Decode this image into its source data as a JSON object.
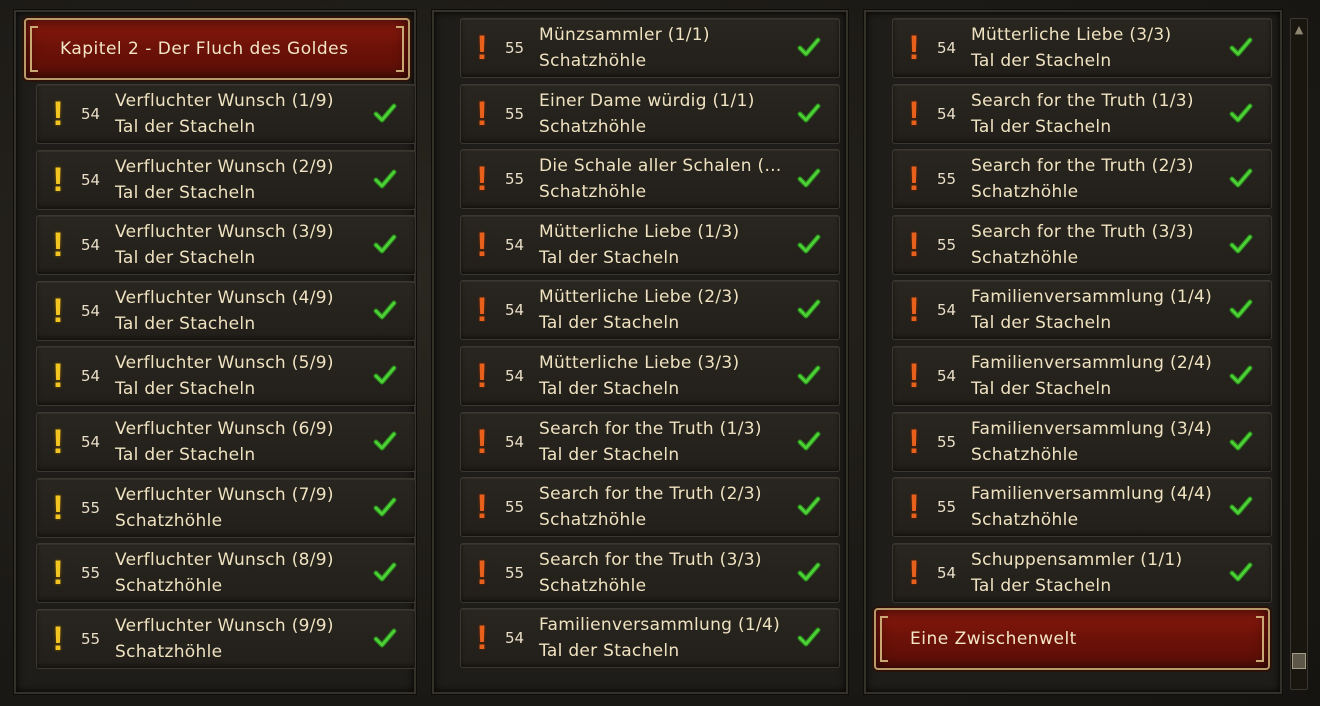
{
  "chapters": [
    {
      "title": "Kapitel 2 - Der Fluch des Goldes"
    },
    {
      "title": "Eine Zwischenwelt"
    }
  ],
  "colors": {
    "yellow_marker": "#f2c523",
    "orange_marker": "#e8611c",
    "check": "#3fbf2a",
    "chapter_red": "#6e1208"
  },
  "icons": {
    "marker": "exclamation-icon",
    "done": "checkmark-icon"
  },
  "quests": {
    "col1": [
      {
        "level": "54",
        "name": "Verfluchter Wunsch (1/9)",
        "zone": "Tal der Stacheln",
        "marker": "yellow"
      },
      {
        "level": "54",
        "name": "Verfluchter Wunsch (2/9)",
        "zone": "Tal der Stacheln",
        "marker": "yellow"
      },
      {
        "level": "54",
        "name": "Verfluchter Wunsch (3/9)",
        "zone": "Tal der Stacheln",
        "marker": "yellow"
      },
      {
        "level": "54",
        "name": "Verfluchter Wunsch (4/9)",
        "zone": "Tal der Stacheln",
        "marker": "yellow"
      },
      {
        "level": "54",
        "name": "Verfluchter Wunsch (5/9)",
        "zone": "Tal der Stacheln",
        "marker": "yellow"
      },
      {
        "level": "54",
        "name": "Verfluchter Wunsch (6/9)",
        "zone": "Tal der Stacheln",
        "marker": "yellow"
      },
      {
        "level": "55",
        "name": "Verfluchter Wunsch (7/9)",
        "zone": "Schatzhöhle",
        "marker": "yellow"
      },
      {
        "level": "55",
        "name": "Verfluchter Wunsch (8/9)",
        "zone": "Schatzhöhle",
        "marker": "yellow"
      },
      {
        "level": "55",
        "name": "Verfluchter Wunsch (9/9)",
        "zone": "Schatzhöhle",
        "marker": "yellow"
      }
    ],
    "col2": [
      {
        "level": "55",
        "name": "Münzsammler (1/1)",
        "zone": "Schatzhöhle",
        "marker": "orange"
      },
      {
        "level": "55",
        "name": "Einer Dame würdig (1/1)",
        "zone": "Schatzhöhle",
        "marker": "orange"
      },
      {
        "level": "55",
        "name": "Die Schale aller Schalen (…",
        "zone": "Schatzhöhle",
        "marker": "orange"
      },
      {
        "level": "54",
        "name": "Mütterliche Liebe (1/3)",
        "zone": "Tal der Stacheln",
        "marker": "orange"
      },
      {
        "level": "54",
        "name": "Mütterliche Liebe (2/3)",
        "zone": "Tal der Stacheln",
        "marker": "orange"
      },
      {
        "level": "54",
        "name": "Mütterliche Liebe (3/3)",
        "zone": "Tal der Stacheln",
        "marker": "orange"
      },
      {
        "level": "54",
        "name": "Search for the Truth (1/3)",
        "zone": "Tal der Stacheln",
        "marker": "orange"
      },
      {
        "level": "55",
        "name": "Search for the Truth (2/3)",
        "zone": "Schatzhöhle",
        "marker": "orange"
      },
      {
        "level": "55",
        "name": "Search for the Truth (3/3)",
        "zone": "Schatzhöhle",
        "marker": "orange"
      },
      {
        "level": "54",
        "name": "Familienversammlung (1/4)",
        "zone": "Tal der Stacheln",
        "marker": "orange"
      }
    ],
    "col3": [
      {
        "level": "54",
        "name": "Mütterliche Liebe (3/3)",
        "zone": "Tal der Stacheln",
        "marker": "orange"
      },
      {
        "level": "54",
        "name": "Search for the Truth (1/3)",
        "zone": "Tal der Stacheln",
        "marker": "orange"
      },
      {
        "level": "55",
        "name": "Search for the Truth (2/3)",
        "zone": "Schatzhöhle",
        "marker": "orange"
      },
      {
        "level": "55",
        "name": "Search for the Truth (3/3)",
        "zone": "Schatzhöhle",
        "marker": "orange"
      },
      {
        "level": "54",
        "name": "Familienversammlung (1/4)",
        "zone": "Tal der Stacheln",
        "marker": "orange"
      },
      {
        "level": "54",
        "name": "Familienversammlung (2/4)",
        "zone": "Tal der Stacheln",
        "marker": "orange"
      },
      {
        "level": "55",
        "name": "Familienversammlung (3/4)",
        "zone": "Schatzhöhle",
        "marker": "orange"
      },
      {
        "level": "55",
        "name": "Familienversammlung (4/4)",
        "zone": "Schatzhöhle",
        "marker": "orange"
      },
      {
        "level": "54",
        "name": "Schuppensammler (1/1)",
        "zone": "Tal der Stacheln",
        "marker": "orange"
      }
    ]
  }
}
